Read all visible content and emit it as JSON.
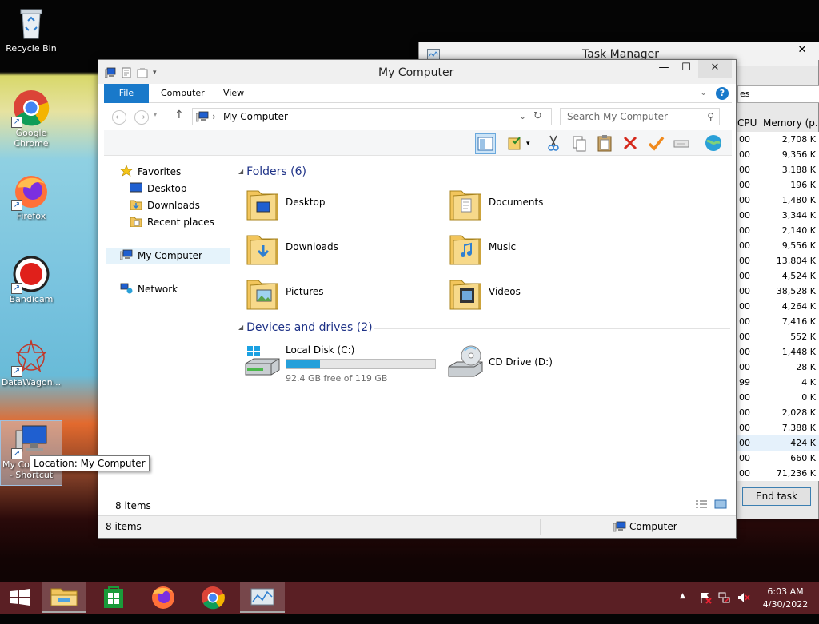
{
  "desktop": {
    "icons": [
      {
        "label": "Recycle Bin",
        "icon": "recycle-bin-icon"
      },
      {
        "label": "Google Chrome",
        "icon": "chrome-icon"
      },
      {
        "label": "Firefox",
        "icon": "firefox-icon"
      },
      {
        "label": "Bandicam",
        "icon": "bandicam-icon"
      },
      {
        "label": "DataWagon...",
        "icon": "datawagon-icon"
      },
      {
        "label": "My Computer - Shortcut",
        "label_visible": "My Co",
        "label_line2": "- Shortcut",
        "icon": "computer-icon"
      }
    ],
    "tooltip": "Location: My Computer"
  },
  "task_manager": {
    "title": "Task Manager",
    "tab_fragment": "es",
    "columns": {
      "cpu": "CPU",
      "memory": "Memory (p."
    },
    "rows": [
      {
        "cpu": "00",
        "mem": "2,708 K"
      },
      {
        "cpu": "00",
        "mem": "9,356 K"
      },
      {
        "cpu": "00",
        "mem": "3,188 K"
      },
      {
        "cpu": "00",
        "mem": "196 K"
      },
      {
        "cpu": "00",
        "mem": "1,480 K"
      },
      {
        "cpu": "00",
        "mem": "3,344 K"
      },
      {
        "cpu": "00",
        "mem": "2,140 K"
      },
      {
        "cpu": "00",
        "mem": "9,556 K"
      },
      {
        "cpu": "00",
        "mem": "13,804 K"
      },
      {
        "cpu": "00",
        "mem": "4,524 K"
      },
      {
        "cpu": "00",
        "mem": "38,528 K"
      },
      {
        "cpu": "00",
        "mem": "4,264 K"
      },
      {
        "cpu": "00",
        "mem": "7,416 K"
      },
      {
        "cpu": "00",
        "mem": "552 K"
      },
      {
        "cpu": "00",
        "mem": "1,448 K"
      },
      {
        "cpu": "00",
        "mem": "28 K"
      },
      {
        "cpu": "99",
        "mem": "4 K"
      },
      {
        "cpu": "00",
        "mem": "0 K"
      },
      {
        "cpu": "00",
        "mem": "2,028 K"
      },
      {
        "cpu": "00",
        "mem": "7,388 K"
      },
      {
        "cpu": "00",
        "mem": "424 K"
      },
      {
        "cpu": "00",
        "mem": "660 K"
      },
      {
        "cpu": "00",
        "mem": "71,236 K"
      }
    ],
    "selected_row": 20,
    "end_task_label": "End task",
    "controls": {
      "minimize": "—",
      "maximize": "☐",
      "close": "✕"
    }
  },
  "explorer": {
    "title": "My Computer",
    "controls": {
      "minimize": "—",
      "maximize": "☐",
      "close": "✕"
    },
    "ribbon_tabs": {
      "file": "File",
      "computer": "Computer",
      "view": "View"
    },
    "help": "?",
    "address": "My Computer",
    "address_sep": "›",
    "search_placeholder": "Search My Computer",
    "nav": {
      "favorites": "Favorites",
      "desktop": "Desktop",
      "downloads": "Downloads",
      "recent": "Recent places",
      "computer": "My Computer",
      "network": "Network"
    },
    "groups": {
      "folders": "Folders (6)",
      "drives": "Devices and drives (2)"
    },
    "folders": [
      {
        "label": "Desktop",
        "icon": "desktop-folder-icon"
      },
      {
        "label": "Documents",
        "icon": "documents-folder-icon"
      },
      {
        "label": "Downloads",
        "icon": "downloads-folder-icon"
      },
      {
        "label": "Music",
        "icon": "music-folder-icon"
      },
      {
        "label": "Pictures",
        "icon": "pictures-folder-icon"
      },
      {
        "label": "Videos",
        "icon": "videos-folder-icon"
      }
    ],
    "drives": {
      "local": {
        "label": "Local Disk (C:)",
        "free": "92.4 GB free of 119 GB",
        "used_fraction": 0.224
      },
      "cd": {
        "label": "CD Drive (D:)"
      }
    },
    "status_inner": "8 items",
    "status_bottom": "8 items",
    "status_location": "Computer"
  },
  "taskbar": {
    "apps": [
      "start-icon",
      "file-explorer-icon",
      "store-icon",
      "firefox-icon",
      "chrome-icon",
      "task-manager-icon"
    ],
    "time": "6:03 AM",
    "date": "4/30/2022",
    "up_arrow": "▲"
  },
  "colors": {
    "accent": "#1979ca",
    "taskbar": "#5a1f24",
    "link": "#1e3287",
    "drive_bar": "#26a0da"
  }
}
